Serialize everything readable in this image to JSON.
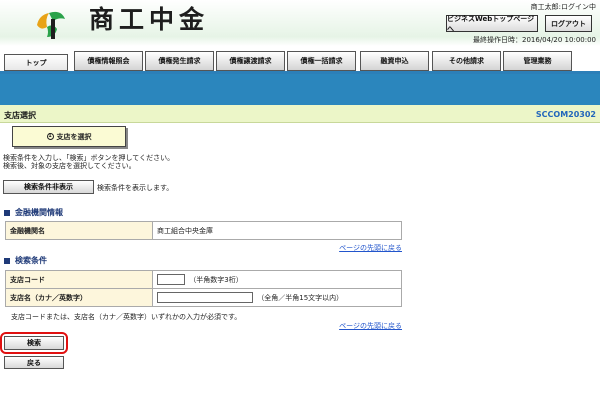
{
  "header": {
    "logo_text": "商工中金",
    "user_name": "商工太郎:ログイン中",
    "toppage_label": "ビジネスWebトップページへ",
    "logout_label": "ログアウト",
    "last_operation": "最終操作日時：2016/04/20 10:00:00"
  },
  "tabs": [
    {
      "label": "トップ"
    },
    {
      "label": "債権情報照会"
    },
    {
      "label": "債権発生請求"
    },
    {
      "label": "債権譲渡請求"
    },
    {
      "label": "債権一括請求"
    },
    {
      "label": "融資申込"
    },
    {
      "label": "その他請求"
    },
    {
      "label": "管理業務"
    }
  ],
  "page": {
    "title": "支店選択",
    "code": "SCCOM20302",
    "step_label": "支店を選択",
    "step_number": "①",
    "instructions": [
      "検索条件を入力し、「検索」ボタンを押してください。",
      "検索後、対象の支店を選択してください。"
    ],
    "show_conditions_label": "検索条件非表示",
    "show_conditions_note": "検索条件を表示します。"
  },
  "financial_section": {
    "heading": "金融機関情報",
    "label": "金融機関名",
    "value": "商工組合中央金庫",
    "page_top_link": "ページの先頭に戻る"
  },
  "search_section": {
    "heading": "検索条件",
    "branch_code_label": "支店コード",
    "branch_code_value": "",
    "branch_code_hint": "（半角数字3桁）",
    "branch_name_label": "支店名（カナ／英数字）",
    "branch_name_value": "",
    "branch_name_hint": "（全角／半角15文字以内）",
    "note": "支店コードまたは、支店名（カナ／英数字）いずれかの入力が必須です。",
    "page_top_link": "ページの先頭に戻る"
  },
  "actions": {
    "search_label": "検索",
    "back_label": "戻る"
  },
  "colors": {
    "blue_band": "#2b86bd",
    "title_bar": "#ecf6c8",
    "highlight_ring": "#e01010",
    "section_heading": "#1f3a78"
  }
}
